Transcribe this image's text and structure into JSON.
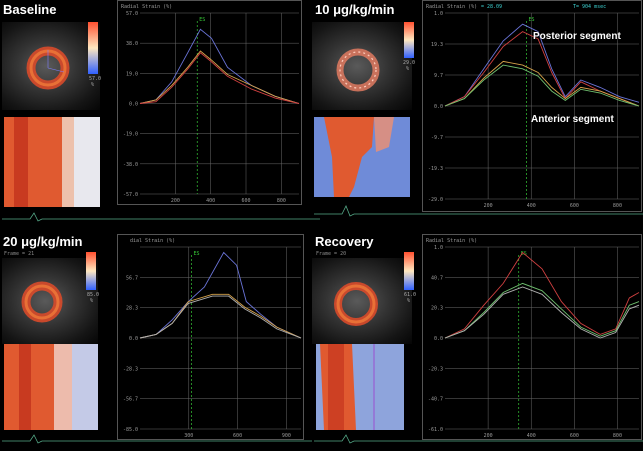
{
  "panels": [
    {
      "id": "baseline",
      "label": "Baseline",
      "frame_text": "",
      "colorbar": {
        "top": "57.0",
        "bottom": "57.0",
        "unit": "%"
      },
      "plot_title": "Radial Strain (%)",
      "header_values": [],
      "y_ticks": [
        "57.0",
        "38.0",
        "19.0",
        "0.0",
        "-19.0",
        "-38.0",
        "-57.0"
      ],
      "x_ticks": [
        "200",
        "400",
        "600",
        "800"
      ],
      "es_label": "ES"
    },
    {
      "id": "dose10",
      "label": "10 μg/kg/min",
      "frame_text": "",
      "colorbar": {
        "top": "29.0",
        "bottom": "29.0",
        "unit": "%"
      },
      "plot_title": "Radial Strain (%)",
      "header_values": [
        "= 28.09",
        "T= 904 msec"
      ],
      "y_ticks": [
        "1.0",
        "19.3",
        "9.7",
        "0.0",
        "-9.7",
        "-19.3",
        "-29.0"
      ],
      "x_ticks": [
        "200",
        "400",
        "600",
        "800"
      ],
      "es_label": "ES"
    },
    {
      "id": "dose20",
      "label": "20 μg/kg/min",
      "frame_text": "Frame = 21",
      "colorbar": {
        "top": "85.0",
        "bottom": "85.0",
        "unit": "%"
      },
      "plot_title": "dial Strain (%)",
      "header_values": [],
      "y_ticks": [
        "",
        "56.7",
        "28.3",
        "0.0",
        "-28.3",
        "-56.7",
        "-85.0"
      ],
      "x_ticks": [
        "300",
        "600",
        "900"
      ],
      "es_label": "ES"
    },
    {
      "id": "recovery",
      "label": "Recovery",
      "frame_text": "Frame = 20",
      "colorbar": {
        "top": "61.0",
        "bottom": "61.0",
        "unit": "%"
      },
      "plot_title": "Radial Strain (%)",
      "header_values": [],
      "y_ticks": [
        "1.0",
        "40.7",
        "20.3",
        "0.0",
        "-20.3",
        "-40.7",
        "-61.0"
      ],
      "x_ticks": [
        "200",
        "400",
        "600",
        "800"
      ],
      "es_label": "ES"
    }
  ],
  "annotations": {
    "posterior": "Posterior segment",
    "anterior": "Anterior segment"
  },
  "colors": {
    "background": "#000000",
    "grid": "#6b6b6b",
    "es_line": "#37c837",
    "curve_blue": "#6a74d8",
    "curve_orange": "#d6a24a",
    "curve_red": "#d04040",
    "curve_green": "#6fbf6f",
    "curve_gray": "#b0b0b0"
  }
}
